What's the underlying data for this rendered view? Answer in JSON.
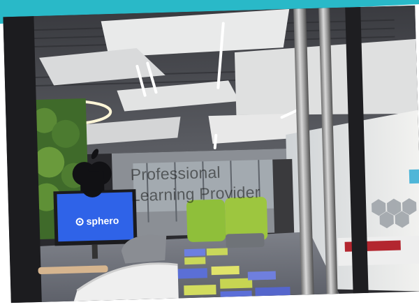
{
  "overlay": {
    "line1": "Professional",
    "line2": "Learning Provider"
  },
  "screen": {
    "brand": "sphero"
  },
  "colors": {
    "accent": "#29b9c8",
    "screen_blue": "#2f63e8",
    "pod_green": "#8fbf3a"
  }
}
